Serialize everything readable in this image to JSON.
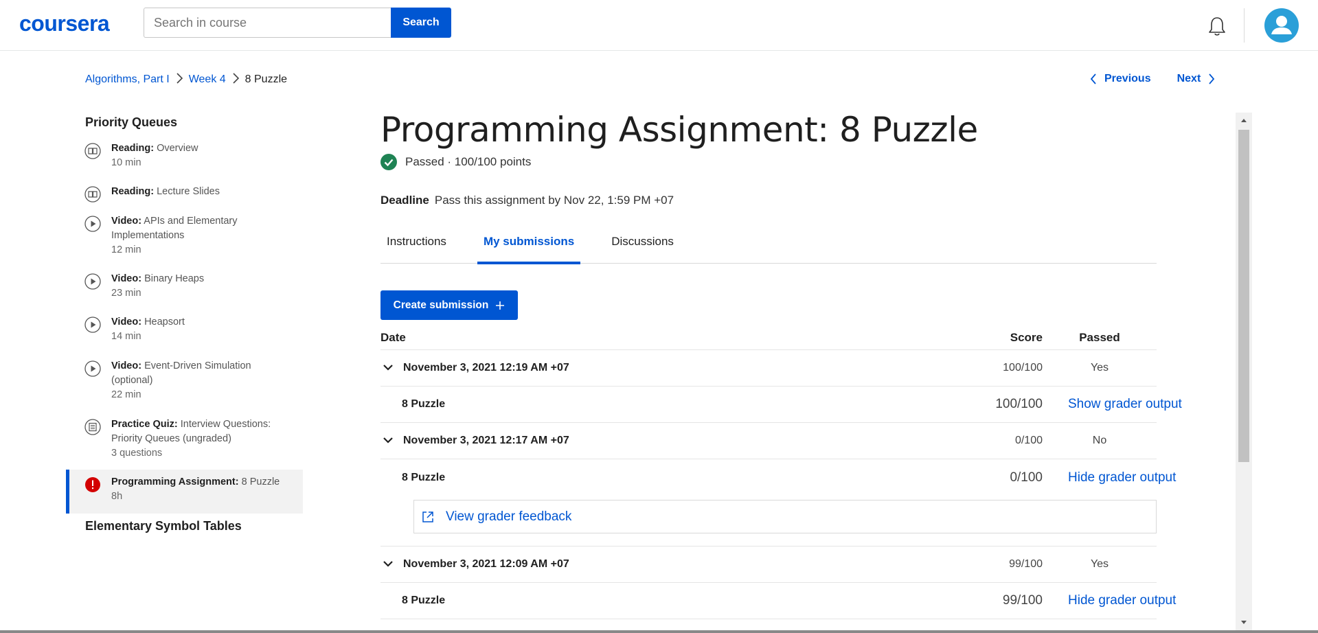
{
  "header": {
    "logo": "coursera",
    "search_placeholder": "Search in course",
    "search_button": "Search"
  },
  "breadcrumb": {
    "course": "Algorithms, Part I",
    "week": "Week 4",
    "current": "8 Puzzle"
  },
  "nav": {
    "previous": "Previous",
    "next": "Next"
  },
  "sidebar": {
    "section_title": "Priority Queues",
    "items": [
      {
        "type": "Reading:",
        "title": "Overview",
        "meta": "10 min",
        "icon": "book-icon"
      },
      {
        "type": "Reading:",
        "title": "Lecture Slides",
        "meta": "",
        "icon": "book-icon"
      },
      {
        "type": "Video:",
        "title": "APIs and Elementary Implementations",
        "meta": "12 min",
        "icon": "play-icon"
      },
      {
        "type": "Video:",
        "title": "Binary Heaps",
        "meta": "23 min",
        "icon": "play-icon"
      },
      {
        "type": "Video:",
        "title": "Heapsort",
        "meta": "14 min",
        "icon": "play-icon"
      },
      {
        "type": "Video:",
        "title": "Event-Driven Simulation (optional)",
        "meta": "22 min",
        "icon": "play-icon"
      },
      {
        "type": "Practice Quiz:",
        "title": "Interview Questions: Priority Queues (ungraded)",
        "meta": "3 questions",
        "icon": "quiz-icon"
      },
      {
        "type": "Programming Assignment:",
        "title": "8 Puzzle",
        "meta": "8h",
        "icon": "alert-icon"
      }
    ],
    "next_section_title": "Elementary Symbol Tables"
  },
  "main": {
    "title": "Programming Assignment: 8 Puzzle",
    "status": "Passed · 100/100 points",
    "deadline_label": "Deadline",
    "deadline_text": "Pass this assignment by Nov 22, 1:59 PM +07",
    "tabs": [
      "Instructions",
      "My submissions",
      "Discussions"
    ],
    "create_button": "Create submission",
    "table_headers": {
      "date": "Date",
      "score": "Score",
      "passed": "Passed"
    },
    "submissions": [
      {
        "date": "November 3, 2021 12:19 AM +07",
        "score": "100/100",
        "passed": "Yes",
        "part": "8 Puzzle",
        "part_score": "100/100",
        "action": "Show grader output"
      },
      {
        "date": "November 3, 2021 12:17 AM +07",
        "score": "0/100",
        "passed": "No",
        "part": "8 Puzzle",
        "part_score": "0/100",
        "action": "Hide grader output",
        "feedback": "View grader feedback"
      },
      {
        "date": "November 3, 2021 12:09 AM +07",
        "score": "99/100",
        "passed": "Yes",
        "part": "8 Puzzle",
        "part_score": "99/100",
        "action": "Hide grader output"
      }
    ]
  },
  "colors": {
    "brand": "#0056d2",
    "success": "#1f8354",
    "alert": "#d30001"
  }
}
